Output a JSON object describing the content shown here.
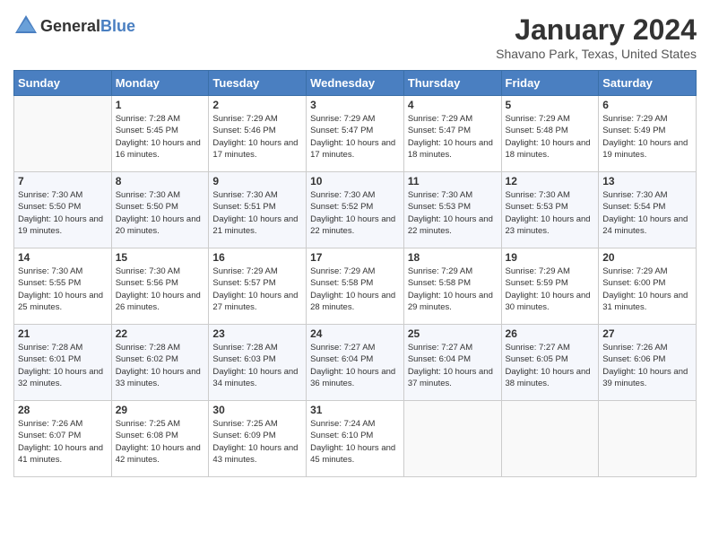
{
  "header": {
    "logo_general": "General",
    "logo_blue": "Blue",
    "month_title": "January 2024",
    "location": "Shavano Park, Texas, United States"
  },
  "days_of_week": [
    "Sunday",
    "Monday",
    "Tuesday",
    "Wednesday",
    "Thursday",
    "Friday",
    "Saturday"
  ],
  "weeks": [
    [
      {
        "num": "",
        "sunrise": "",
        "sunset": "",
        "daylight": ""
      },
      {
        "num": "1",
        "sunrise": "Sunrise: 7:28 AM",
        "sunset": "Sunset: 5:45 PM",
        "daylight": "Daylight: 10 hours and 16 minutes."
      },
      {
        "num": "2",
        "sunrise": "Sunrise: 7:29 AM",
        "sunset": "Sunset: 5:46 PM",
        "daylight": "Daylight: 10 hours and 17 minutes."
      },
      {
        "num": "3",
        "sunrise": "Sunrise: 7:29 AM",
        "sunset": "Sunset: 5:47 PM",
        "daylight": "Daylight: 10 hours and 17 minutes."
      },
      {
        "num": "4",
        "sunrise": "Sunrise: 7:29 AM",
        "sunset": "Sunset: 5:47 PM",
        "daylight": "Daylight: 10 hours and 18 minutes."
      },
      {
        "num": "5",
        "sunrise": "Sunrise: 7:29 AM",
        "sunset": "Sunset: 5:48 PM",
        "daylight": "Daylight: 10 hours and 18 minutes."
      },
      {
        "num": "6",
        "sunrise": "Sunrise: 7:29 AM",
        "sunset": "Sunset: 5:49 PM",
        "daylight": "Daylight: 10 hours and 19 minutes."
      }
    ],
    [
      {
        "num": "7",
        "sunrise": "Sunrise: 7:30 AM",
        "sunset": "Sunset: 5:50 PM",
        "daylight": "Daylight: 10 hours and 19 minutes."
      },
      {
        "num": "8",
        "sunrise": "Sunrise: 7:30 AM",
        "sunset": "Sunset: 5:50 PM",
        "daylight": "Daylight: 10 hours and 20 minutes."
      },
      {
        "num": "9",
        "sunrise": "Sunrise: 7:30 AM",
        "sunset": "Sunset: 5:51 PM",
        "daylight": "Daylight: 10 hours and 21 minutes."
      },
      {
        "num": "10",
        "sunrise": "Sunrise: 7:30 AM",
        "sunset": "Sunset: 5:52 PM",
        "daylight": "Daylight: 10 hours and 22 minutes."
      },
      {
        "num": "11",
        "sunrise": "Sunrise: 7:30 AM",
        "sunset": "Sunset: 5:53 PM",
        "daylight": "Daylight: 10 hours and 22 minutes."
      },
      {
        "num": "12",
        "sunrise": "Sunrise: 7:30 AM",
        "sunset": "Sunset: 5:53 PM",
        "daylight": "Daylight: 10 hours and 23 minutes."
      },
      {
        "num": "13",
        "sunrise": "Sunrise: 7:30 AM",
        "sunset": "Sunset: 5:54 PM",
        "daylight": "Daylight: 10 hours and 24 minutes."
      }
    ],
    [
      {
        "num": "14",
        "sunrise": "Sunrise: 7:30 AM",
        "sunset": "Sunset: 5:55 PM",
        "daylight": "Daylight: 10 hours and 25 minutes."
      },
      {
        "num": "15",
        "sunrise": "Sunrise: 7:30 AM",
        "sunset": "Sunset: 5:56 PM",
        "daylight": "Daylight: 10 hours and 26 minutes."
      },
      {
        "num": "16",
        "sunrise": "Sunrise: 7:29 AM",
        "sunset": "Sunset: 5:57 PM",
        "daylight": "Daylight: 10 hours and 27 minutes."
      },
      {
        "num": "17",
        "sunrise": "Sunrise: 7:29 AM",
        "sunset": "Sunset: 5:58 PM",
        "daylight": "Daylight: 10 hours and 28 minutes."
      },
      {
        "num": "18",
        "sunrise": "Sunrise: 7:29 AM",
        "sunset": "Sunset: 5:58 PM",
        "daylight": "Daylight: 10 hours and 29 minutes."
      },
      {
        "num": "19",
        "sunrise": "Sunrise: 7:29 AM",
        "sunset": "Sunset: 5:59 PM",
        "daylight": "Daylight: 10 hours and 30 minutes."
      },
      {
        "num": "20",
        "sunrise": "Sunrise: 7:29 AM",
        "sunset": "Sunset: 6:00 PM",
        "daylight": "Daylight: 10 hours and 31 minutes."
      }
    ],
    [
      {
        "num": "21",
        "sunrise": "Sunrise: 7:28 AM",
        "sunset": "Sunset: 6:01 PM",
        "daylight": "Daylight: 10 hours and 32 minutes."
      },
      {
        "num": "22",
        "sunrise": "Sunrise: 7:28 AM",
        "sunset": "Sunset: 6:02 PM",
        "daylight": "Daylight: 10 hours and 33 minutes."
      },
      {
        "num": "23",
        "sunrise": "Sunrise: 7:28 AM",
        "sunset": "Sunset: 6:03 PM",
        "daylight": "Daylight: 10 hours and 34 minutes."
      },
      {
        "num": "24",
        "sunrise": "Sunrise: 7:27 AM",
        "sunset": "Sunset: 6:04 PM",
        "daylight": "Daylight: 10 hours and 36 minutes."
      },
      {
        "num": "25",
        "sunrise": "Sunrise: 7:27 AM",
        "sunset": "Sunset: 6:04 PM",
        "daylight": "Daylight: 10 hours and 37 minutes."
      },
      {
        "num": "26",
        "sunrise": "Sunrise: 7:27 AM",
        "sunset": "Sunset: 6:05 PM",
        "daylight": "Daylight: 10 hours and 38 minutes."
      },
      {
        "num": "27",
        "sunrise": "Sunrise: 7:26 AM",
        "sunset": "Sunset: 6:06 PM",
        "daylight": "Daylight: 10 hours and 39 minutes."
      }
    ],
    [
      {
        "num": "28",
        "sunrise": "Sunrise: 7:26 AM",
        "sunset": "Sunset: 6:07 PM",
        "daylight": "Daylight: 10 hours and 41 minutes."
      },
      {
        "num": "29",
        "sunrise": "Sunrise: 7:25 AM",
        "sunset": "Sunset: 6:08 PM",
        "daylight": "Daylight: 10 hours and 42 minutes."
      },
      {
        "num": "30",
        "sunrise": "Sunrise: 7:25 AM",
        "sunset": "Sunset: 6:09 PM",
        "daylight": "Daylight: 10 hours and 43 minutes."
      },
      {
        "num": "31",
        "sunrise": "Sunrise: 7:24 AM",
        "sunset": "Sunset: 6:10 PM",
        "daylight": "Daylight: 10 hours and 45 minutes."
      },
      {
        "num": "",
        "sunrise": "",
        "sunset": "",
        "daylight": ""
      },
      {
        "num": "",
        "sunrise": "",
        "sunset": "",
        "daylight": ""
      },
      {
        "num": "",
        "sunrise": "",
        "sunset": "",
        "daylight": ""
      }
    ]
  ]
}
